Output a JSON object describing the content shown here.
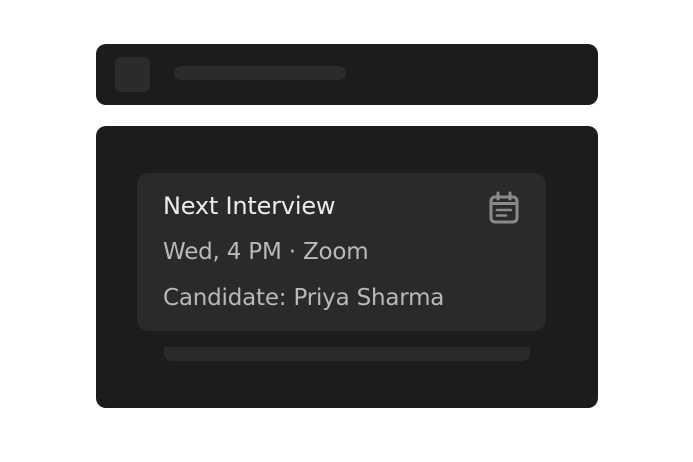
{
  "card": {
    "title": "Next Interview",
    "when": "Wed, 4 PM · Zoom",
    "candidate": "Candidate: Priya Sharma",
    "icon": "calendar-icon"
  },
  "colors": {
    "panel_background": "#1c1c1c",
    "card_background": "#2a2a2a",
    "title_text": "#ececec",
    "secondary_text": "#b9b9b9",
    "icon": "#8a8a8a"
  }
}
